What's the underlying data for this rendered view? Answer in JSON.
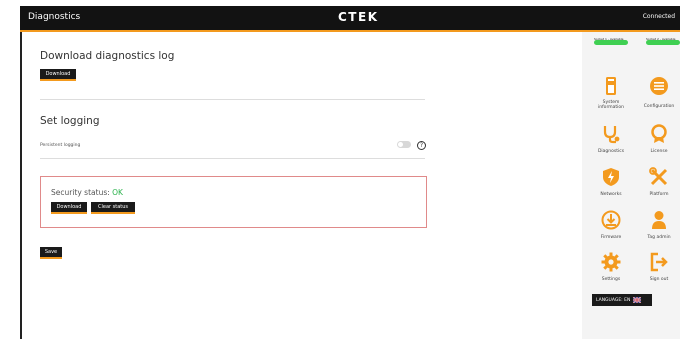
{
  "header": {
    "title": "Diagnostics",
    "brand": "CTEK",
    "connection_status": "Connected"
  },
  "download_section": {
    "heading": "Download diagnostics log",
    "button_label": "Download"
  },
  "logging_section": {
    "heading": "Set logging",
    "toggle_label": "Persistent logging",
    "toggle_on": false,
    "help_glyph": "?"
  },
  "security": {
    "label": "Security status:",
    "value": "OK",
    "value_color": "#2bb24c",
    "download_label": "Download",
    "clear_label": "Clear status"
  },
  "save_label": "Save",
  "sidebar": {
    "status_pills": [
      {
        "label": "Socket 1 - Available",
        "color": "#3fcf52"
      },
      {
        "label": "Socket 2 - Available",
        "color": "#3fcf52"
      }
    ],
    "menu": [
      {
        "label": "System information",
        "icon": "system-information-icon"
      },
      {
        "label": "Configuration",
        "icon": "configuration-icon"
      },
      {
        "label": "Diagnostics",
        "icon": "stethoscope-icon"
      },
      {
        "label": "License",
        "icon": "license-ribbon-icon"
      },
      {
        "label": "Networks",
        "icon": "network-shield-icon"
      },
      {
        "label": "Platform",
        "icon": "platform-tools-icon"
      },
      {
        "label": "Firmware",
        "icon": "firmware-download-icon"
      },
      {
        "label": "Tag admin",
        "icon": "tag-admin-user-icon"
      },
      {
        "label": "Settings",
        "icon": "settings-gear-icon"
      },
      {
        "label": "Sign out",
        "icon": "sign-out-icon"
      }
    ],
    "language_label": "LANGUAGE: EN"
  },
  "colors": {
    "accent": "#f39a1e",
    "topbar": "#121212",
    "icon_orange": "#f39a1e",
    "status_green": "#3fcf52"
  }
}
